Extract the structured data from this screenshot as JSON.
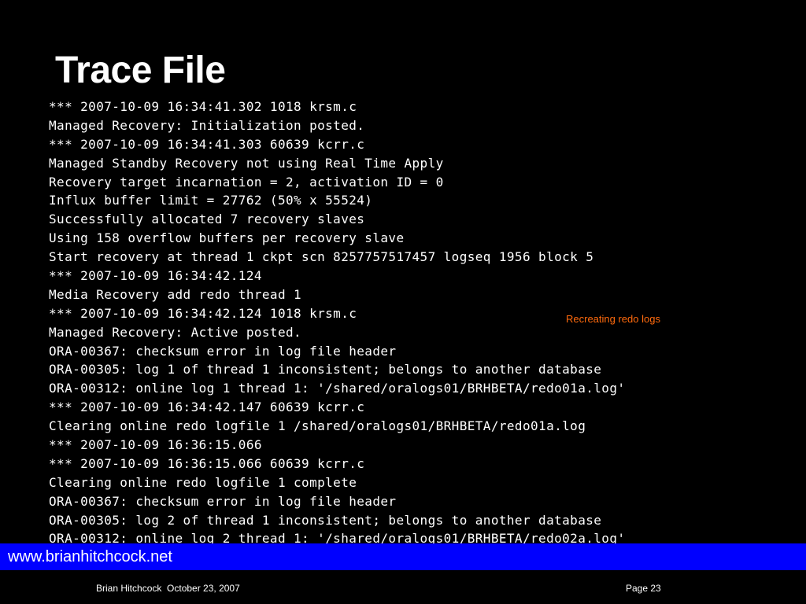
{
  "slide": {
    "title": "Trace File",
    "log_lines": [
      "*** 2007-10-09 16:34:41.302 1018 krsm.c",
      "Managed Recovery: Initialization posted.",
      "*** 2007-10-09 16:34:41.303 60639 kcrr.c",
      "Managed Standby Recovery not using Real Time Apply",
      "Recovery target incarnation = 2, activation ID = 0",
      "Influx buffer limit = 27762 (50% x 55524)",
      "Successfully allocated 7 recovery slaves",
      "Using 158 overflow buffers per recovery slave",
      "Start recovery at thread 1 ckpt scn 8257757517457 logseq 1956 block 5",
      "*** 2007-10-09 16:34:42.124",
      "Media Recovery add redo thread 1",
      "*** 2007-10-09 16:34:42.124 1018 krsm.c",
      "Managed Recovery: Active posted.",
      "ORA-00367: checksum error in log file header",
      "ORA-00305: log 1 of thread 1 inconsistent; belongs to another database",
      "ORA-00312: online log 1 thread 1: '/shared/oralogs01/BRHBETA/redo01a.log'",
      "*** 2007-10-09 16:34:42.147 60639 kcrr.c",
      "Clearing online redo logfile 1 /shared/oralogs01/BRHBETA/redo01a.log",
      "*** 2007-10-09 16:36:15.066",
      "*** 2007-10-09 16:36:15.066 60639 kcrr.c",
      "Clearing online redo logfile 1 complete",
      "ORA-00367: checksum error in log file header",
      "ORA-00305: log 2 of thread 1 inconsistent; belongs to another database",
      "ORA-00312: online log 2 thread 1: '/shared/oralogs01/BRHBETA/redo02a.log'"
    ],
    "annotation": "Recreating redo logs"
  },
  "footer": {
    "url": "www.brianhitchcock.net",
    "author_date": "Brian Hitchcock  October 23, 2007",
    "page": "Page 23"
  },
  "colors": {
    "background": "#000000",
    "text": "#ffffff",
    "annotation": "#ff6a0d",
    "url_bar": "#0000ff"
  }
}
